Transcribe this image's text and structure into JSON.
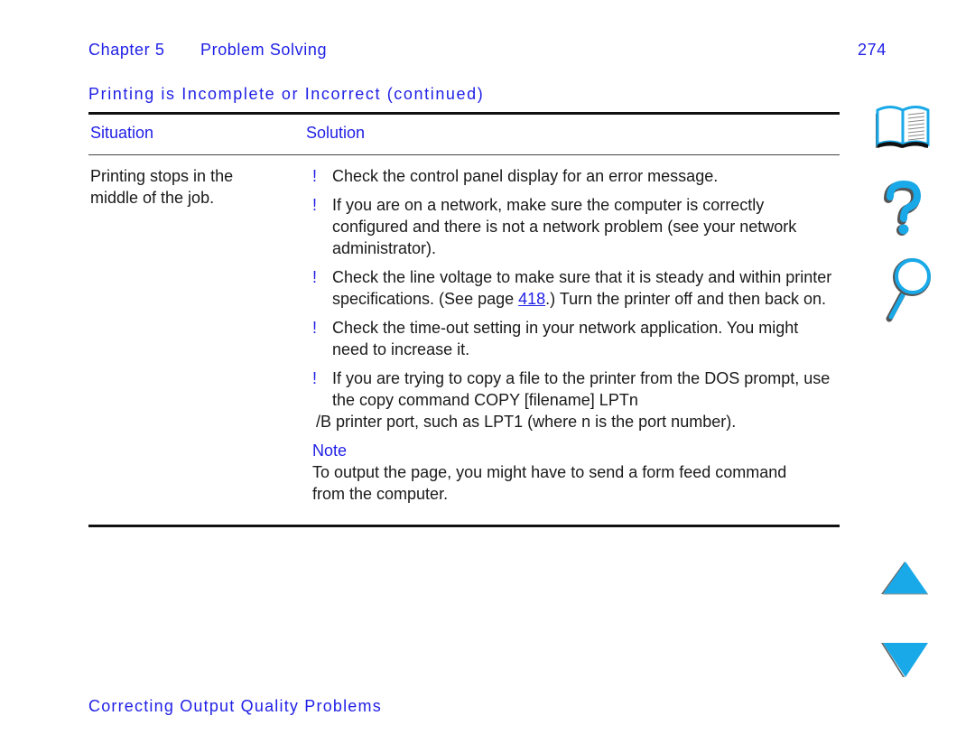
{
  "header": {
    "chapter": "Chapter 5",
    "chapter_title": "Problem Solving",
    "page_number": "274"
  },
  "section_title": "Printing is Incomplete or Incorrect (continued)",
  "table": {
    "columns": [
      "Situation",
      "Solution"
    ],
    "rows": [
      {
        "situation": "Printing stops in the middle of the job.",
        "solutions": [
          {
            "bullet": "!",
            "text": "Check the control panel display for an error message."
          },
          {
            "bullet": "!",
            "text": "If you are on a network, make sure the computer is correctly configured and there is not a network problem (see your network administrator)."
          },
          {
            "bullet": "!",
            "text_before": "Check the line voltage to make sure that it is steady and within printer specifications. (See page ",
            "link": "418",
            "text_after": ".) Turn the printer off and then back on."
          },
          {
            "bullet": "!",
            "text": "Check the time-out setting in your network application. You might need to increase it."
          },
          {
            "bullet": "!",
            "text": "If you are trying to copy a file to the printer from the DOS prompt, use the copy command COPY [filename] LPTn",
            "continuation": "/B  printer port, such as LPT1 (where n is the port number)."
          }
        ],
        "note": {
          "label": "Note",
          "text": "To output the page, you might have to send a form feed command from the computer."
        }
      }
    ]
  },
  "footer": "Correcting Output Quality Problems",
  "nav_icons": [
    "book-icon",
    "help-icon",
    "search-icon",
    "previous-page-icon",
    "next-page-icon"
  ],
  "colors": {
    "heading_blue": "#1f1fe6",
    "icon_cyan": "#19a9e8",
    "icon_shadow": "#555555"
  }
}
